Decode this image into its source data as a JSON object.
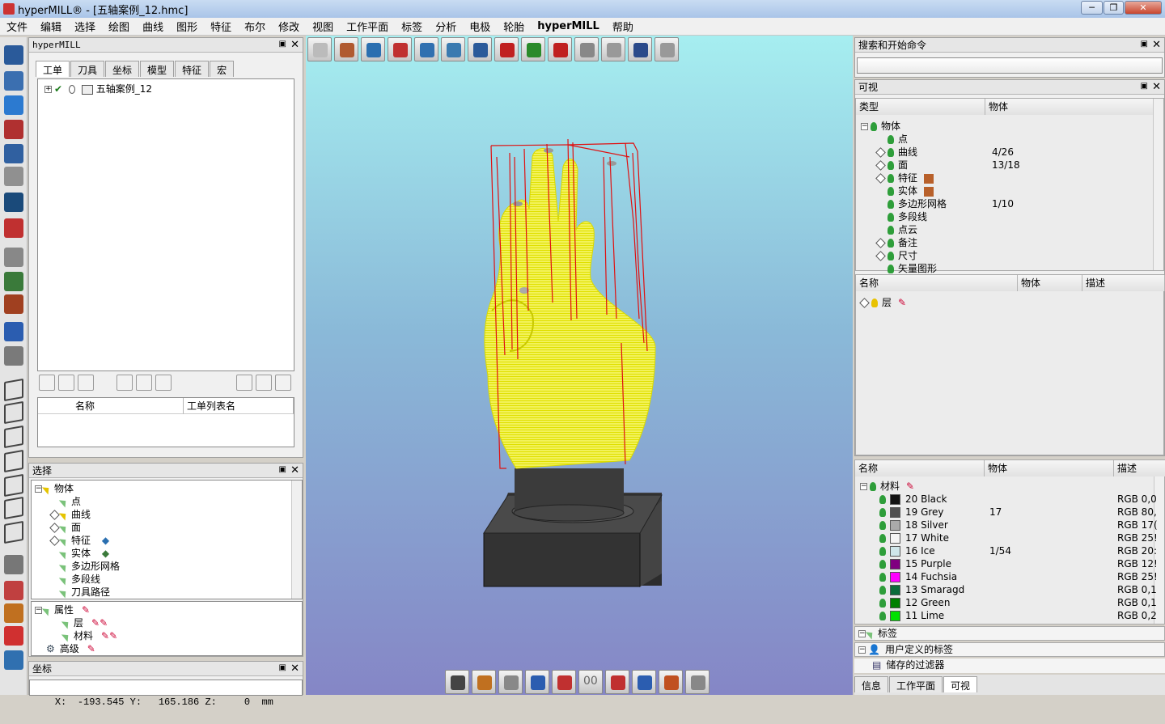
{
  "window": {
    "title": "hyperMILL® - [五轴案例_12.hmc]"
  },
  "menu": [
    "文件",
    "编辑",
    "选择",
    "绘图",
    "曲线",
    "图形",
    "特征",
    "布尔",
    "修改",
    "视图",
    "工作平面",
    "标签",
    "分析",
    "电极",
    "轮胎",
    "hyperMILL",
    "帮助"
  ],
  "left_panel": {
    "title": "hyperMILL",
    "tabs": [
      "工单",
      "刀具",
      "坐标",
      "模型",
      "特征",
      "宏"
    ],
    "job_item": "五轴案例_12",
    "list_headers": [
      "名称",
      "工单列表名"
    ]
  },
  "selection_panel": {
    "title": "选择",
    "root": "物体",
    "items": [
      "点",
      "曲线",
      "面",
      "特征",
      "实体",
      "多边形网格",
      "多段线",
      "刀具路径"
    ],
    "props_root": "属性",
    "props_items": [
      "层",
      "材料"
    ],
    "advanced": "高级"
  },
  "coords_panel": {
    "title": "坐标",
    "x_label": "X:",
    "x_value": "-193.545",
    "y_label": "Y:",
    "y_value": "165.186",
    "z_label": "Z:",
    "z_value": "0",
    "unit": "mm"
  },
  "search_panel": {
    "title": "搜索和开始命令",
    "placeholder": ""
  },
  "visibility_panel": {
    "title": "可视",
    "col_type": "类型",
    "col_object": "物体",
    "root": "物体",
    "rows": [
      {
        "label": "点",
        "value": ""
      },
      {
        "label": "曲线",
        "value": "4/26"
      },
      {
        "label": "面",
        "value": "13/18"
      },
      {
        "label": "特征",
        "value": ""
      },
      {
        "label": "实体",
        "value": ""
      },
      {
        "label": "多边形网格",
        "value": "1/10"
      },
      {
        "label": "多段线",
        "value": ""
      },
      {
        "label": "点云",
        "value": ""
      },
      {
        "label": "备注",
        "value": ""
      },
      {
        "label": "尺寸",
        "value": ""
      },
      {
        "label": "矢量图形",
        "value": ""
      }
    ]
  },
  "layers_panel": {
    "col_name": "名称",
    "col_object": "物体",
    "col_desc": "描述",
    "root": "层"
  },
  "materials_panel": {
    "col_name": "名称",
    "col_object": "物体",
    "col_desc": "描述",
    "root": "材料",
    "rows": [
      {
        "name": "20 Black",
        "obj": "",
        "desc": "RGB 0,0",
        "color": "#111111"
      },
      {
        "name": "19 Grey",
        "obj": "17",
        "desc": "RGB 80,",
        "color": "#505050"
      },
      {
        "name": "18 Silver",
        "obj": "",
        "desc": "RGB 17(",
        "color": "#aaaaaa"
      },
      {
        "name": "17 White",
        "obj": "",
        "desc": "RGB 25!",
        "color": "#f4f4f4"
      },
      {
        "name": "16 Ice",
        "obj": "1/54",
        "desc": "RGB 20:",
        "color": "#cfe6ea"
      },
      {
        "name": "15 Purple",
        "obj": "",
        "desc": "RGB 12!",
        "color": "#800080"
      },
      {
        "name": "14 Fuchsia",
        "obj": "",
        "desc": "RGB 25!",
        "color": "#ff00ff"
      },
      {
        "name": "13 Smaragd",
        "obj": "",
        "desc": "RGB 0,1",
        "color": "#0b6b3a"
      },
      {
        "name": "12 Green",
        "obj": "",
        "desc": "RGB 0,1",
        "color": "#008000"
      },
      {
        "name": "11 Lime",
        "obj": "",
        "desc": "RGB 0,2",
        "color": "#00e000"
      }
    ]
  },
  "tags": {
    "label": "标签",
    "user_tags": "用户定义的标签",
    "saved_filters": "储存的过滤器"
  },
  "bottom_tabs": [
    "信息",
    "工作平面",
    "可视"
  ],
  "bottom_toolbar_label": "00"
}
